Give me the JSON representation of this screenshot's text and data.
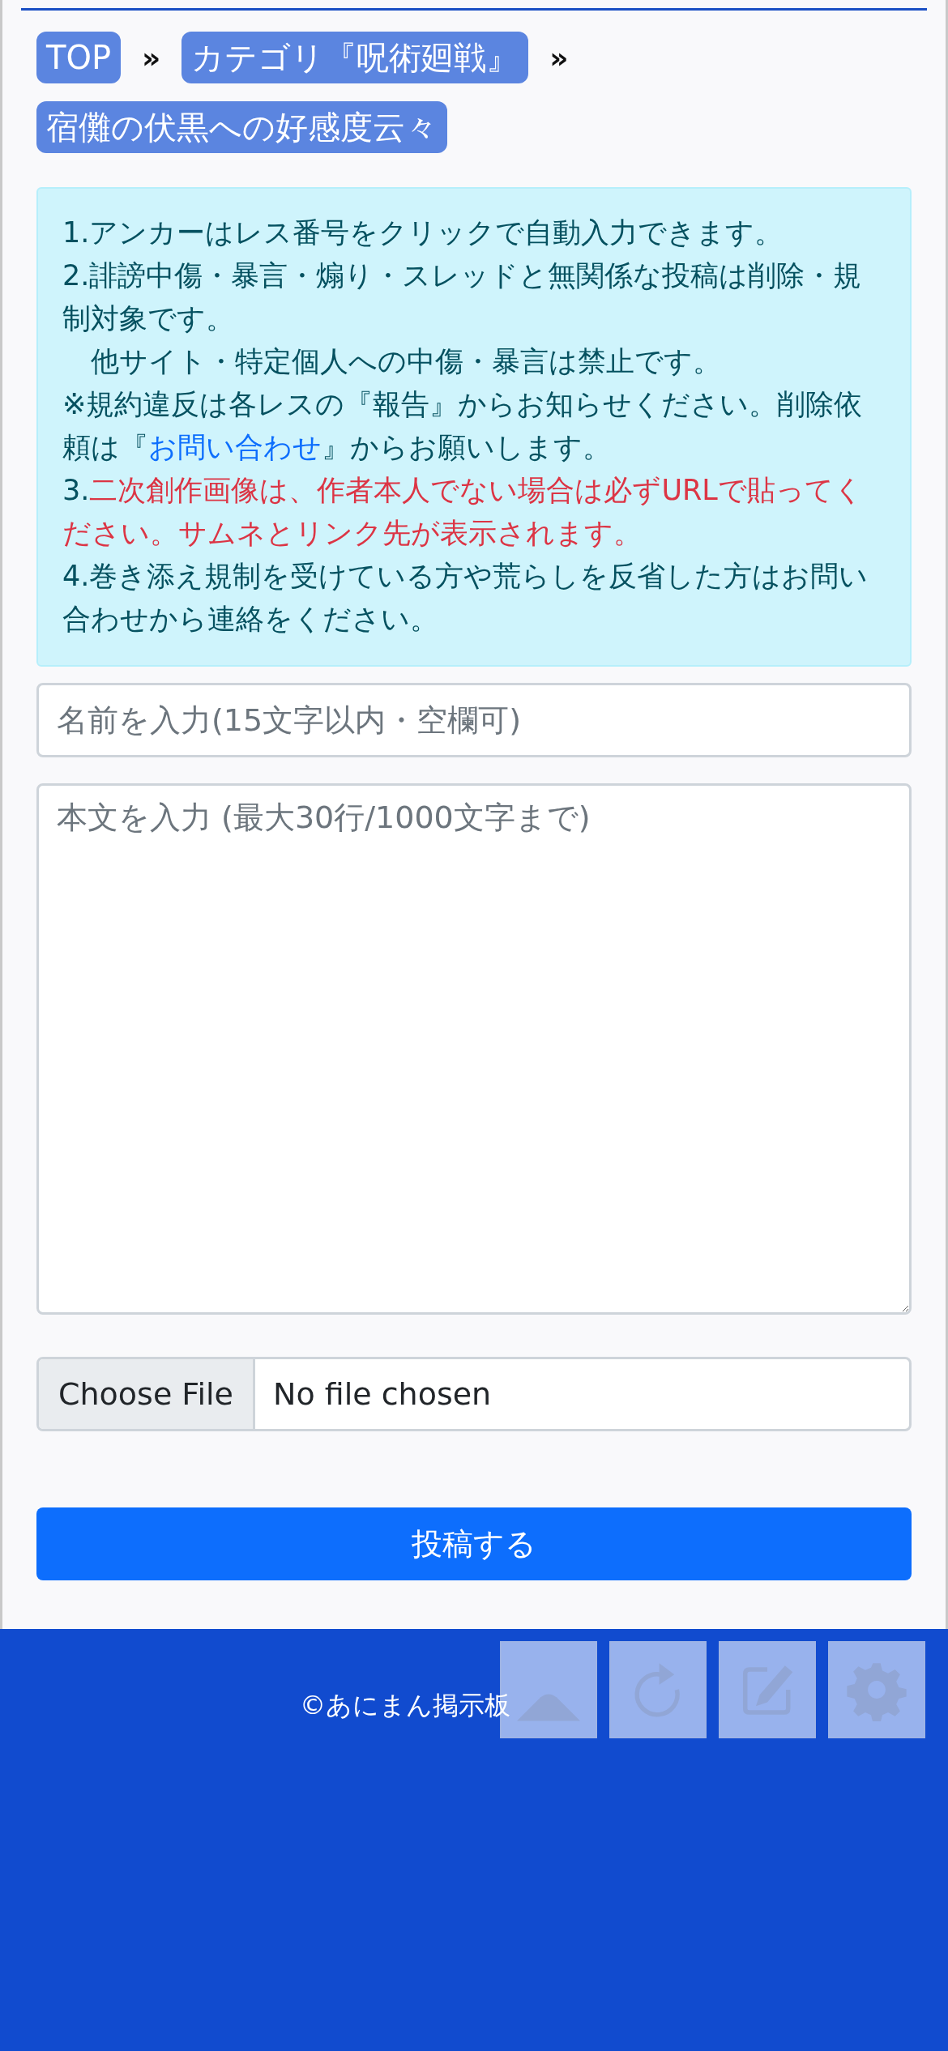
{
  "breadcrumb": {
    "items": [
      {
        "label": "TOP"
      },
      {
        "label": "カテゴリ『呪術廻戦』"
      },
      {
        "label": "宿儺の伏黒への好感度云々"
      }
    ],
    "separator": "»"
  },
  "notice": {
    "paragraphs": [
      [
        {
          "kind": "text",
          "text": "1.アンカーはレス番号をクリックで自動入力できます。"
        }
      ],
      [
        {
          "kind": "text",
          "text": "2.誹謗中傷・暴言・煽り・スレッドと無関係な投稿は削除・規制対象です。"
        }
      ],
      [
        {
          "kind": "text",
          "text": "　他サイト・特定個人への中傷・暴言は禁止です。"
        }
      ],
      [
        {
          "kind": "text",
          "text": "※規約違反は各レスの『報告』からお知らせください。削除依頼は『"
        },
        {
          "kind": "link",
          "text": "お問い合わせ"
        },
        {
          "kind": "text",
          "text": "』からお願いします。"
        }
      ],
      [
        {
          "kind": "text",
          "text": "3."
        },
        {
          "kind": "warning",
          "text": "二次創作画像は、作者本人でない場合は必ずURLで貼ってください。サムネとリンク先が表示されます。"
        }
      ],
      [
        {
          "kind": "text",
          "text": "4.巻き添え規制を受けている方や荒らしを反省した方はお問い合わせから連絡をください。"
        }
      ]
    ]
  },
  "form": {
    "name_placeholder": "名前を入力(15文字以内・空欄可)",
    "body_placeholder": "本文を入力 (最大30行/1000文字まで)",
    "file_button": "Choose File",
    "file_status": "No file chosen",
    "submit": "投稿する"
  },
  "footer": {
    "copyright": "©あにまん掲示板",
    "buttons": [
      {
        "kind": "top"
      },
      {
        "kind": "reload"
      },
      {
        "kind": "write"
      },
      {
        "kind": "settings"
      }
    ]
  }
}
